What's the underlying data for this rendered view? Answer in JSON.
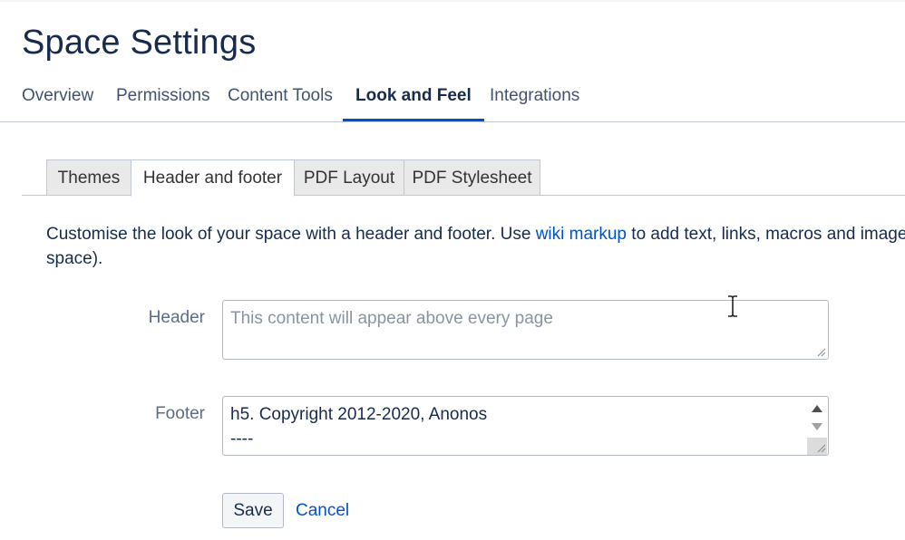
{
  "page": {
    "title": "Space Settings"
  },
  "main_nav": {
    "items": [
      {
        "label": "Overview"
      },
      {
        "label": "Permissions"
      },
      {
        "label": "Content Tools"
      },
      {
        "label": "Look and Feel",
        "active": true
      },
      {
        "label": "Integrations"
      }
    ]
  },
  "sub_tabs": {
    "items": [
      {
        "label": "Themes"
      },
      {
        "label": "Header and footer",
        "active": true
      },
      {
        "label": "PDF Layout"
      },
      {
        "label": "PDF Stylesheet"
      }
    ]
  },
  "description": {
    "before_link": "Customise the look of your space with a header and footer. Use ",
    "link_text": "wiki markup",
    "after_link": " to add text, links, macros and images",
    "line2": "space)."
  },
  "form": {
    "header": {
      "label": "Header",
      "value": "",
      "placeholder": "This content will appear above every page"
    },
    "footer": {
      "label": "Footer",
      "line1": "h5. Copyright 2012-2020, Anonos",
      "line2": "----"
    },
    "save_label": "Save",
    "cancel_label": "Cancel"
  },
  "colors": {
    "accent": "#0052cc",
    "title": "#172b4d",
    "link": "#0052cc"
  },
  "icons": {
    "cursor": "text-cursor-icon",
    "resize": "resize-grip-icon"
  }
}
